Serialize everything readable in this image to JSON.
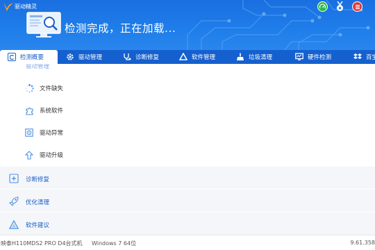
{
  "app": {
    "title": "驱动精灵"
  },
  "header": {
    "status_title": "检测完成，正在加载..."
  },
  "tabs": [
    {
      "label": "检测概要",
      "icon": "summary-icon",
      "active": true
    },
    {
      "label": "驱动管理",
      "icon": "gear-icon",
      "active": false
    },
    {
      "label": "诊断修复",
      "icon": "stethoscope-icon",
      "active": false
    },
    {
      "label": "软件管理",
      "icon": "software-icon",
      "active": false
    },
    {
      "label": "垃圾清理",
      "icon": "broom-icon",
      "active": false
    },
    {
      "label": "硬件检测",
      "icon": "monitor-icon",
      "active": false
    },
    {
      "label": "百宝",
      "icon": "dropbox-icon",
      "active": false
    }
  ],
  "content": {
    "partial_section": "驱动管理",
    "sub_items": [
      {
        "label": "文件缺失",
        "icon": "loading-spinner-icon"
      },
      {
        "label": "系统软件",
        "icon": "puzzle-icon"
      },
      {
        "label": "驱动异常",
        "icon": "warning-box-icon"
      },
      {
        "label": "驱动升级",
        "icon": "upgrade-arrow-icon"
      }
    ],
    "categories": [
      {
        "label": "诊断修复",
        "icon": "diagnosis-icon"
      },
      {
        "label": "优化清理",
        "icon": "rocket-icon"
      },
      {
        "label": "软件建议",
        "icon": "software-triangle-icon"
      }
    ]
  },
  "footer": {
    "device": "映泰H110MDS2 PRO D4台式机",
    "os": "Windows 7 64位",
    "version": "9.61.358"
  },
  "colors": {
    "header_blue": "#1f7eea",
    "tabbar_blue": "#1560cf",
    "accent_blue": "#1a5fc8"
  }
}
